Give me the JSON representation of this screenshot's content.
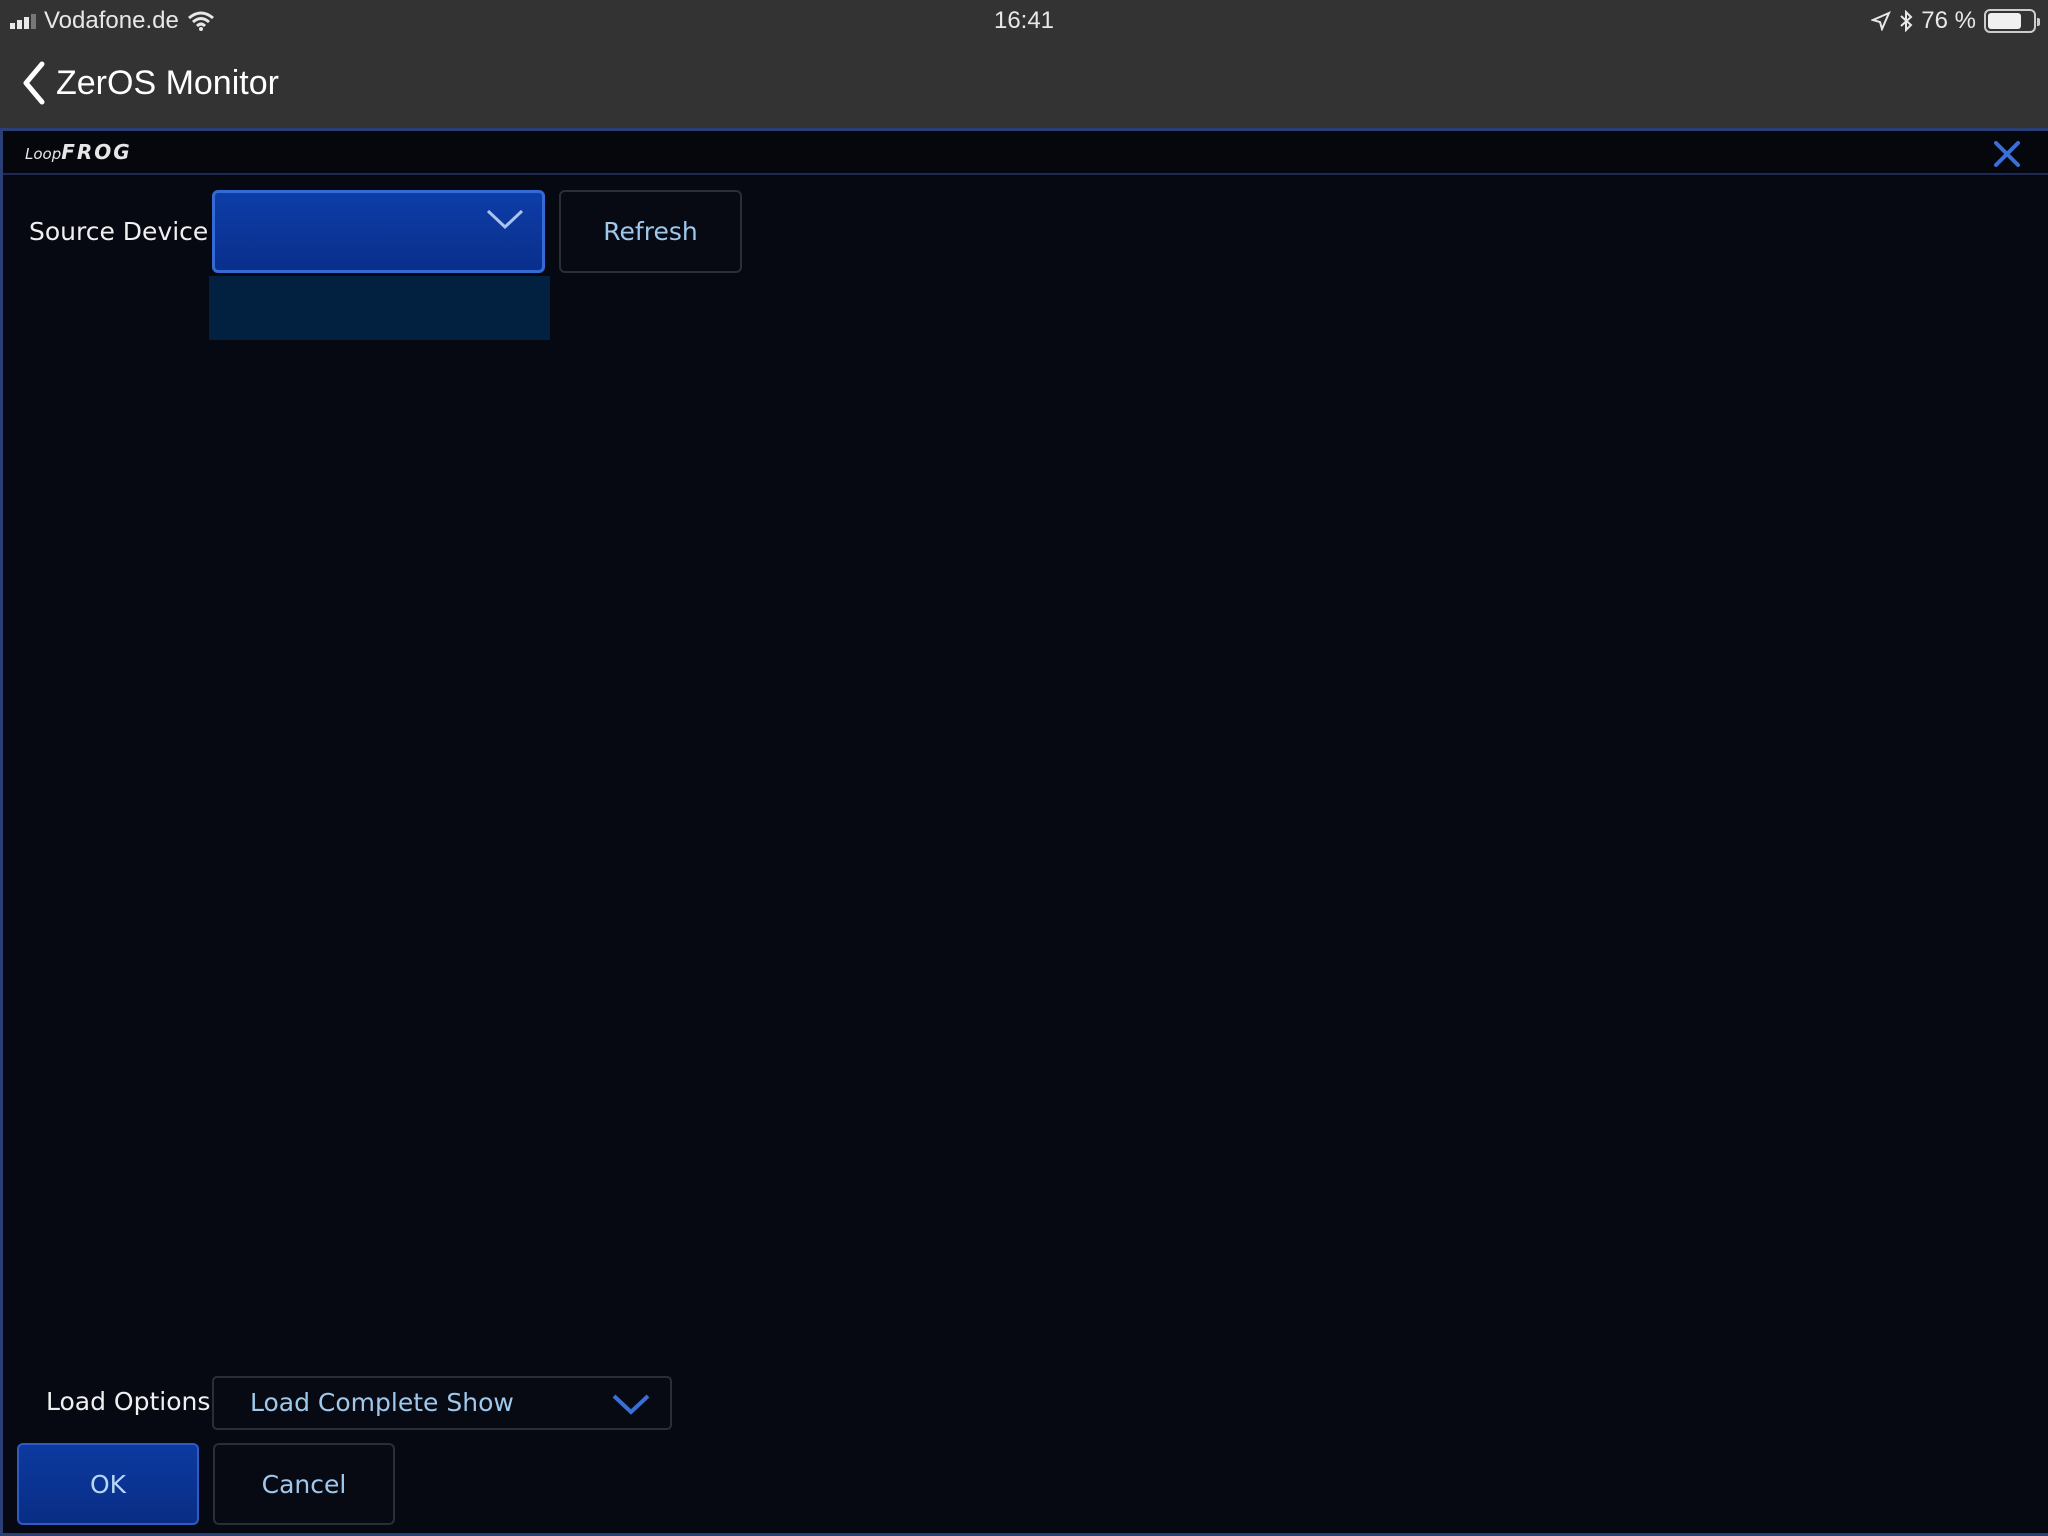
{
  "status_bar": {
    "carrier": "Vodafone.de",
    "time": "16:41",
    "battery_percent": "76 %",
    "battery_level": 0.76,
    "icons": [
      "signal-icon",
      "wifi-icon",
      "location-icon",
      "bluetooth-icon",
      "battery-icon"
    ]
  },
  "nav": {
    "back_label": "ZerOS Monitor",
    "back_icon": "chevron-left-icon"
  },
  "window": {
    "logo_small": "Loop",
    "logo_big": "FROG",
    "close_icon": "close-icon"
  },
  "source": {
    "label": "Source Device",
    "selected_value": "",
    "refresh_label": "Refresh"
  },
  "load_options": {
    "label": "Load Options",
    "selected_value": "Load Complete Show"
  },
  "actions": {
    "ok_label": "OK",
    "cancel_label": "Cancel"
  },
  "colors": {
    "status_bar_bg": "#333333",
    "window_bg": "#060911",
    "accent_blue": "#0d3da8",
    "button_text": "#9ec8ec"
  }
}
